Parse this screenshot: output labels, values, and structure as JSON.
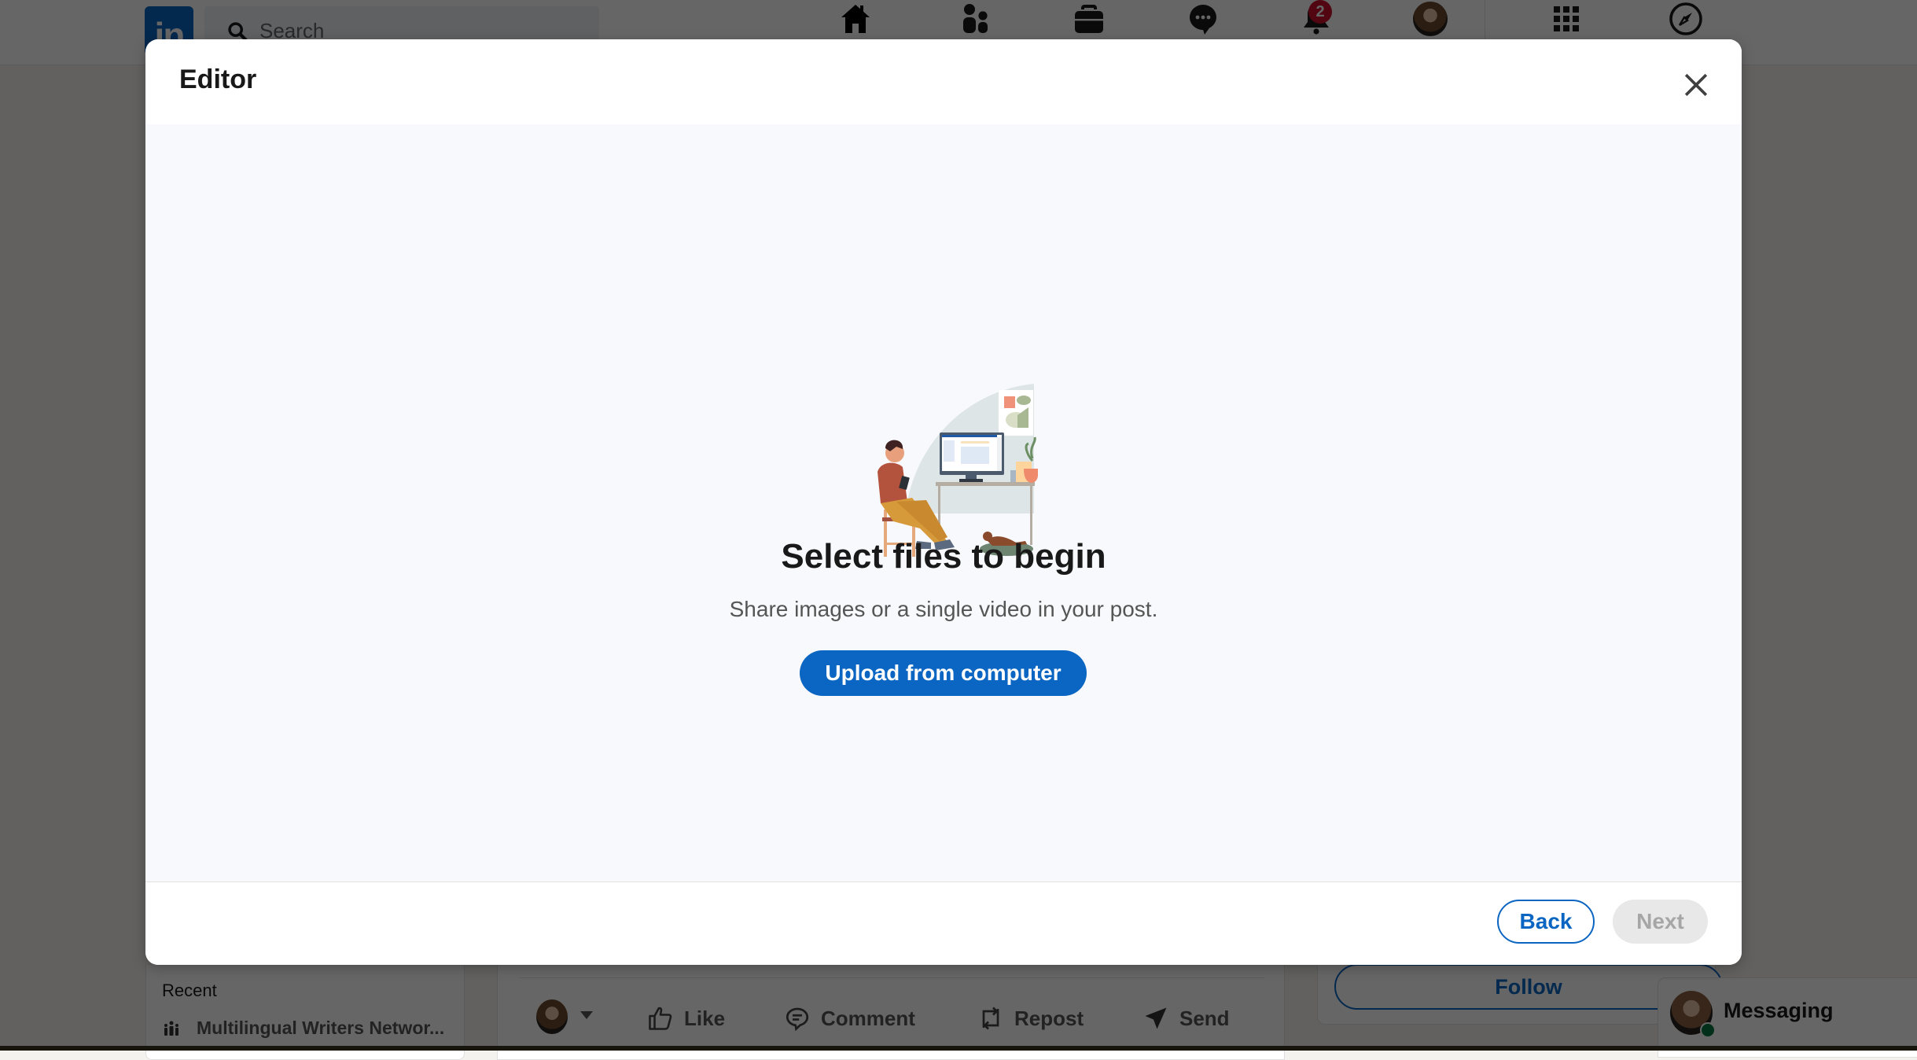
{
  "topnav": {
    "logo_text": "in",
    "search_placeholder": "Search",
    "icons": [
      "home-icon",
      "my-network-icon",
      "jobs-icon",
      "messaging-icon",
      "notifications-icon",
      "me-avatar",
      "work-grid-icon",
      "advertise-compass-icon"
    ],
    "notification_count": "2"
  },
  "modal": {
    "title": "Editor",
    "close_label": "Close",
    "empty_state": {
      "title": "Select files to begin",
      "subtitle": "Share images or a single video in your post.",
      "upload_button": "Upload from computer"
    },
    "footer": {
      "back_label": "Back",
      "next_label": "Next",
      "next_disabled": true
    }
  },
  "background": {
    "sidebar": {
      "recent_label": "Recent",
      "recent_items": [
        {
          "label": "Multilingual Writers Networ...",
          "icon": "group-icon"
        }
      ]
    },
    "post_actions": [
      {
        "label": "Like",
        "icon": "like-icon"
      },
      {
        "label": "Comment",
        "icon": "comment-icon"
      },
      {
        "label": "Repost",
        "icon": "repost-icon"
      },
      {
        "label": "Send",
        "icon": "send-icon"
      }
    ],
    "follow_label": "Follow",
    "messaging_label": "Messaging"
  },
  "colors": {
    "brand": "#0a66c2",
    "badge": "#cb112d",
    "online": "#057642"
  }
}
